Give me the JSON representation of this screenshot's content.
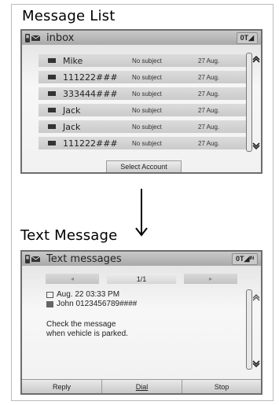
{
  "message_list": {
    "section_title": "Message List",
    "header": {
      "title": "inbox",
      "status": "0T◢",
      "icon": "phone-envelope-icon"
    },
    "rows": [
      {
        "name": "Mike",
        "subject": "No subject",
        "date": "27 Aug."
      },
      {
        "name": "111222###",
        "subject": "No subject",
        "date": "27 Aug."
      },
      {
        "name": "333444###",
        "subject": "No subject",
        "date": "27 Aug."
      },
      {
        "name": "Jack",
        "subject": "No subject",
        "date": "27 Aug."
      },
      {
        "name": "Jack",
        "subject": "No subject",
        "date": "27 Aug."
      },
      {
        "name": "111222###",
        "subject": "No subject",
        "date": "27 Aug."
      }
    ],
    "select_account_label": "Select Account"
  },
  "text_message": {
    "section_title": "Text Message",
    "header": {
      "title": "Text messages",
      "status": "0T◢ᴵᴺ",
      "icon": "phone-envelope-icon"
    },
    "page_indicator": "1/1",
    "prev_symbol": "◂",
    "next_symbol": "▸",
    "date_line": "Aug. 22 03:33 PM",
    "sender_line": "John 0123456789####",
    "body_line1": "Check the message",
    "body_line2": "when vehicle is parked.",
    "footer": {
      "reply": "Reply",
      "dial": "Dial",
      "stop": "Stop"
    }
  },
  "scroll_up_symbol": "⌃",
  "scroll_down_symbol": "⌄"
}
